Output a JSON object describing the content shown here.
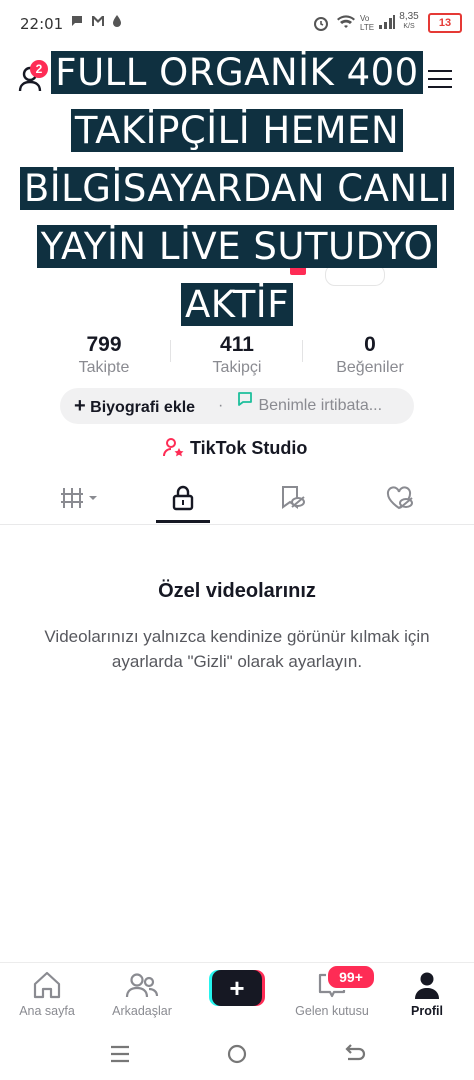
{
  "status_bar": {
    "time": "22:01",
    "net_speed": "8,35",
    "net_unit": "K/S",
    "network_type": "Vo LTE",
    "battery": "13"
  },
  "header": {
    "notification_count": "2"
  },
  "overlay": {
    "lines": [
      "FULL ORGANİK 400",
      "TAKİPÇİLİ HEMEN",
      "BİLGİSAYARDAN CANLI",
      "YAYİN LİVE SUTUDYO",
      "AKTİF"
    ]
  },
  "stats": [
    {
      "value": "799",
      "label": "Takipte"
    },
    {
      "value": "411",
      "label": "Takipçi"
    },
    {
      "value": "0",
      "label": "Beğeniler"
    }
  ],
  "bio": {
    "add_label": "Biyografi ekle",
    "separator": "·",
    "contact_label": "Benimle irtibata..."
  },
  "studio": {
    "label": "TikTok Studio"
  },
  "tabs": [
    "videos-grid",
    "private",
    "reposts",
    "liked"
  ],
  "empty_state": {
    "title": "Özel videolarınız",
    "body": "Videolarınızı yalnızca kendinize görünür kılmak için ayarlarda \"Gizli\" olarak ayarlayın."
  },
  "bottom_nav": {
    "items": [
      {
        "label": "Ana sayfa"
      },
      {
        "label": "Arkadaşlar"
      },
      {
        "label": ""
      },
      {
        "label": "Gelen kutusu"
      },
      {
        "label": "Profil"
      }
    ],
    "inbox_badge": "99+"
  },
  "colors": {
    "accent": "#fe2c55",
    "teal": "#25f4ee",
    "overlay_bg": "#0f3040"
  }
}
